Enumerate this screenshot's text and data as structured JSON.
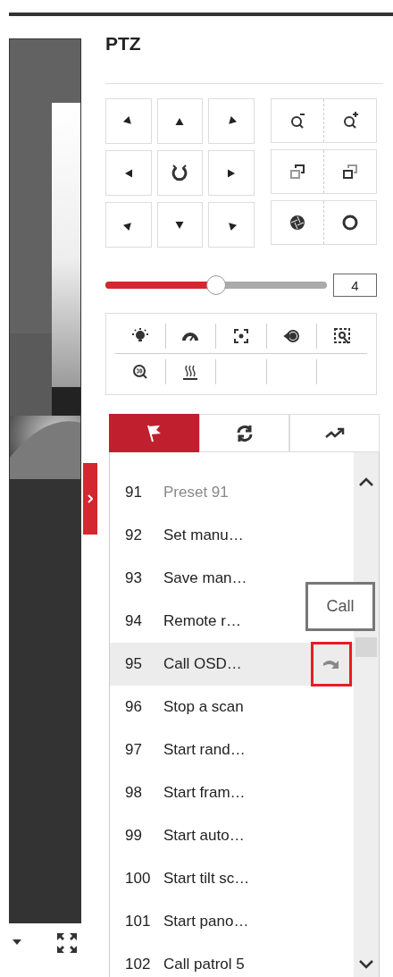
{
  "panel": {
    "title": "PTZ"
  },
  "speed": {
    "level": 0.5,
    "value": "4"
  },
  "preset_tabs": [
    {
      "kind": "preset",
      "selected": true
    },
    {
      "kind": "patrol",
      "selected": false
    },
    {
      "kind": "pattern",
      "selected": false
    }
  ],
  "presets": [
    {
      "number": "91",
      "name": "Preset 91",
      "disabled": true,
      "selected": false
    },
    {
      "number": "92",
      "name": "Set manu…",
      "disabled": false,
      "selected": false
    },
    {
      "number": "93",
      "name": "Save man…",
      "disabled": false,
      "selected": false
    },
    {
      "number": "94",
      "name": "Remote r…",
      "disabled": false,
      "selected": false
    },
    {
      "number": "95",
      "name": "Call OSD…",
      "disabled": false,
      "selected": true
    },
    {
      "number": "96",
      "name": "Stop a scan",
      "disabled": false,
      "selected": false
    },
    {
      "number": "97",
      "name": "Start rand…",
      "disabled": false,
      "selected": false
    },
    {
      "number": "98",
      "name": "Start fram…",
      "disabled": false,
      "selected": false
    },
    {
      "number": "99",
      "name": "Start auto…",
      "disabled": false,
      "selected": false
    },
    {
      "number": "100",
      "name": "Start tilt sc…",
      "disabled": false,
      "selected": false
    },
    {
      "number": "101",
      "name": "Start pano…",
      "disabled": false,
      "selected": false
    },
    {
      "number": "102",
      "name": "Call patrol 5",
      "disabled": false,
      "selected": false
    }
  ],
  "tooltip": "Call"
}
